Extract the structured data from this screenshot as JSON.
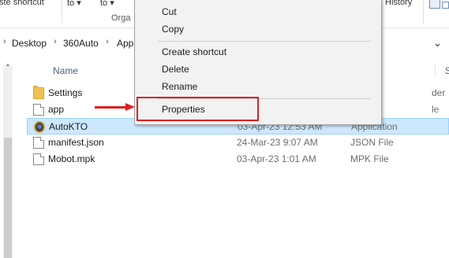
{
  "ribbon": {
    "cut_partial": "ste shortcut",
    "copy_to_partial": "to",
    "move_to_partial": "to",
    "group_partial": "Orga",
    "history": "History"
  },
  "address": {
    "crumbs": [
      "Desktop",
      "360Auto",
      "App"
    ],
    "separator": "›",
    "dropdown_icon": "chevron-down-icon"
  },
  "columns": {
    "name": "Name",
    "partial_right": "S"
  },
  "files": [
    {
      "name": "Settings",
      "date": "",
      "type": "",
      "type_partial": "der",
      "icon": "folder-icon",
      "selected": false
    },
    {
      "name": "app",
      "date": "",
      "type": "",
      "type_partial": "le",
      "icon": "document-icon",
      "selected": false
    },
    {
      "name": "AutoKTO",
      "date": "03-Apr-23 12:53 AM",
      "type": "Application",
      "type_partial": "",
      "icon": "application-icon",
      "selected": true
    },
    {
      "name": "manifest.json",
      "date": "24-Mar-23 9:07 AM",
      "type": "JSON File",
      "type_partial": "",
      "icon": "document-icon",
      "selected": false
    },
    {
      "name": "Mobot.mpk",
      "date": "03-Apr-23 1:01 AM",
      "type": "MPK File",
      "type_partial": "",
      "icon": "document-icon",
      "selected": false
    }
  ],
  "context_menu": {
    "cut": "Cut",
    "copy": "Copy",
    "create_shortcut": "Create shortcut",
    "delete": "Delete",
    "rename": "Rename",
    "properties": "Properties"
  },
  "colors": {
    "highlight": "#e02020",
    "selection": "#cce8ff"
  }
}
